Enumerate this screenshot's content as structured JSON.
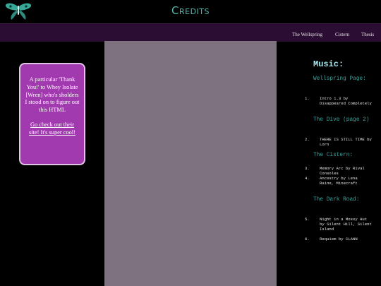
{
  "header": {
    "title": "Credits",
    "logo_icon": "luna-moth-icon",
    "accent_color": "#58b8b0"
  },
  "nav": {
    "items": [
      "The Wellspring",
      "Cistern",
      "Thesis"
    ]
  },
  "thanks": {
    "message": "A particular 'Thank You!' to Whey Isolate [Wren] who's sholders I stood on to figure out this HTML",
    "link_text": "Go check out their site! It's super cool!"
  },
  "music": {
    "title": "Music:",
    "sections": [
      {
        "heading": "Wellspring Page:",
        "tracks": [
          {
            "num": "1.",
            "text": "Intro 1.3 by Disappeared Completely"
          }
        ]
      },
      {
        "heading": "The Dive (page 2)",
        "tracks": [
          {
            "num": "2.",
            "text": "THERE IS STILL TIME by Lorn"
          }
        ]
      },
      {
        "heading": "The Cistern:",
        "tracks": [
          {
            "num": "3.",
            "text": "Memory Arc by Rival Consoles"
          },
          {
            "num": "4.",
            "text": "Ancestry by Lena Raine, Minecraft"
          }
        ]
      },
      {
        "heading": "The Dark Road:",
        "tracks": [
          {
            "num": "5.",
            "text": "Night in a Mossy Hut by Silent Hill, Silent Island"
          },
          {
            "num": "6.",
            "text": "Requiem by CLANN"
          }
        ]
      }
    ]
  }
}
